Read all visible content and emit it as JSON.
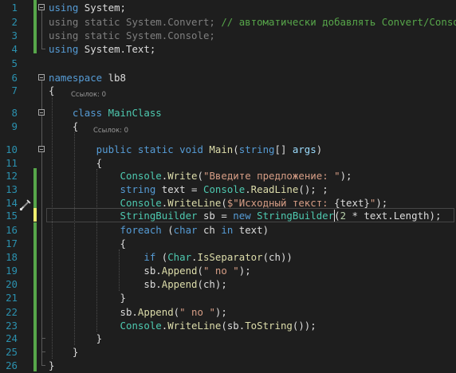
{
  "editor": {
    "language": "C#",
    "lens_label": "Ссылок: 0",
    "lines": [
      {
        "num": "1",
        "tokens": [
          {
            "t": "using",
            "c": "k"
          },
          {
            "t": " System;",
            "c": ""
          }
        ]
      },
      {
        "num": "2",
        "tokens": [
          {
            "t": "using static ",
            "c": "dim"
          },
          {
            "t": "System.Convert; ",
            "c": "dim"
          },
          {
            "t": "// автоматически добавлять Convert/Console",
            "c": "c"
          }
        ]
      },
      {
        "num": "3",
        "tokens": [
          {
            "t": "using static ",
            "c": "dim"
          },
          {
            "t": "System.Console;",
            "c": "dim"
          }
        ]
      },
      {
        "num": "4",
        "tokens": [
          {
            "t": "using",
            "c": "k"
          },
          {
            "t": " System.Text;",
            "c": ""
          }
        ]
      },
      {
        "num": "5",
        "tokens": []
      },
      {
        "num": "6",
        "tokens": [
          {
            "t": "namespace",
            "c": "k"
          },
          {
            "t": " lb8",
            "c": ""
          }
        ]
      },
      {
        "num": "7",
        "tokens": [
          {
            "t": "{",
            "c": ""
          }
        ]
      },
      {
        "num": "8",
        "tokens": [
          {
            "t": "    class ",
            "c": "k"
          },
          {
            "t": "MainClass",
            "c": "t"
          }
        ]
      },
      {
        "num": "9",
        "tokens": [
          {
            "t": "    {",
            "c": ""
          }
        ]
      },
      {
        "num": "10",
        "tokens": [
          {
            "t": "        public static void ",
            "c": "k"
          },
          {
            "t": "Main",
            "c": "m"
          },
          {
            "t": "(",
            "c": ""
          },
          {
            "t": "string",
            "c": "k"
          },
          {
            "t": "[] ",
            "c": ""
          },
          {
            "t": "args",
            "c": "p"
          },
          {
            "t": ")",
            "c": ""
          }
        ]
      },
      {
        "num": "11",
        "tokens": [
          {
            "t": "        {",
            "c": ""
          }
        ]
      },
      {
        "num": "12",
        "tokens": [
          {
            "t": "            ",
            "c": ""
          },
          {
            "t": "Console",
            "c": "t"
          },
          {
            "t": ".",
            "c": ""
          },
          {
            "t": "Write",
            "c": "m"
          },
          {
            "t": "(",
            "c": ""
          },
          {
            "t": "\"Введите предложение: \"",
            "c": "s"
          },
          {
            "t": ");",
            "c": ""
          }
        ]
      },
      {
        "num": "13",
        "tokens": [
          {
            "t": "            ",
            "c": ""
          },
          {
            "t": "string",
            "c": "k"
          },
          {
            "t": " text = ",
            "c": ""
          },
          {
            "t": "Console",
            "c": "t"
          },
          {
            "t": ".",
            "c": ""
          },
          {
            "t": "ReadLine",
            "c": "m"
          },
          {
            "t": "(); ;",
            "c": ""
          }
        ]
      },
      {
        "num": "14",
        "tokens": [
          {
            "t": "            ",
            "c": ""
          },
          {
            "t": "Console",
            "c": "t"
          },
          {
            "t": ".",
            "c": ""
          },
          {
            "t": "WriteLine",
            "c": "m"
          },
          {
            "t": "(",
            "c": ""
          },
          {
            "t": "$\"Исходный текст: ",
            "c": "s"
          },
          {
            "t": "{text}",
            "c": ""
          },
          {
            "t": "\"",
            "c": "s"
          },
          {
            "t": ");",
            "c": ""
          }
        ]
      },
      {
        "num": "15",
        "tokens": [
          {
            "t": "            ",
            "c": ""
          },
          {
            "t": "StringBuilder",
            "c": "t"
          },
          {
            "t": " sb = ",
            "c": ""
          },
          {
            "t": "new ",
            "c": "k"
          },
          {
            "t": "StringBuilder",
            "c": "t"
          },
          {
            "t": "(",
            "c": ""
          },
          {
            "t": "2",
            "c": "num"
          },
          {
            "t": " * text.Length);",
            "c": ""
          }
        ]
      },
      {
        "num": "16",
        "tokens": [
          {
            "t": "            ",
            "c": ""
          },
          {
            "t": "foreach",
            "c": "k"
          },
          {
            "t": " (",
            "c": ""
          },
          {
            "t": "char",
            "c": "k"
          },
          {
            "t": " ch ",
            "c": ""
          },
          {
            "t": "in",
            "c": "k"
          },
          {
            "t": " text)",
            "c": ""
          }
        ]
      },
      {
        "num": "17",
        "tokens": [
          {
            "t": "            {",
            "c": ""
          }
        ]
      },
      {
        "num": "18",
        "tokens": [
          {
            "t": "                ",
            "c": ""
          },
          {
            "t": "if",
            "c": "k"
          },
          {
            "t": " (",
            "c": ""
          },
          {
            "t": "Char",
            "c": "t"
          },
          {
            "t": ".",
            "c": ""
          },
          {
            "t": "IsSeparator",
            "c": "m"
          },
          {
            "t": "(ch))",
            "c": ""
          }
        ]
      },
      {
        "num": "19",
        "tokens": [
          {
            "t": "                sb.",
            "c": ""
          },
          {
            "t": "Append",
            "c": "m"
          },
          {
            "t": "(",
            "c": ""
          },
          {
            "t": "\" no \"",
            "c": "s"
          },
          {
            "t": ");",
            "c": ""
          }
        ]
      },
      {
        "num": "20",
        "tokens": [
          {
            "t": "                sb.",
            "c": ""
          },
          {
            "t": "Append",
            "c": "m"
          },
          {
            "t": "(ch);",
            "c": ""
          }
        ]
      },
      {
        "num": "21",
        "tokens": [
          {
            "t": "            }",
            "c": ""
          }
        ]
      },
      {
        "num": "22",
        "tokens": [
          {
            "t": "            sb.",
            "c": ""
          },
          {
            "t": "Append",
            "c": "m"
          },
          {
            "t": "(",
            "c": ""
          },
          {
            "t": "\" no \"",
            "c": "s"
          },
          {
            "t": ");",
            "c": ""
          }
        ]
      },
      {
        "num": "23",
        "tokens": [
          {
            "t": "            ",
            "c": ""
          },
          {
            "t": "Console",
            "c": "t"
          },
          {
            "t": ".",
            "c": ""
          },
          {
            "t": "WriteLine",
            "c": "m"
          },
          {
            "t": "(sb.",
            "c": ""
          },
          {
            "t": "ToString",
            "c": "m"
          },
          {
            "t": "());",
            "c": ""
          }
        ]
      },
      {
        "num": "24",
        "tokens": [
          {
            "t": "        }",
            "c": ""
          }
        ]
      },
      {
        "num": "25",
        "tokens": [
          {
            "t": "    }",
            "c": ""
          }
        ]
      },
      {
        "num": "26",
        "tokens": [
          {
            "t": "}",
            "c": ""
          }
        ]
      }
    ],
    "current_line": "15"
  },
  "colors": {
    "background": "#1e1e1e",
    "keyword": "#569cd6",
    "type": "#4ec9b0",
    "string": "#d69d85",
    "comment": "#57a64a",
    "method": "#dcdcaa",
    "line_number": "#2b91af",
    "change_bar_saved": "#57a64a",
    "change_bar_unsaved": "#efef6e"
  },
  "icons": {
    "gutter_glyph": "paintbrush-icon",
    "fold_toggle": "collapse-icon"
  }
}
